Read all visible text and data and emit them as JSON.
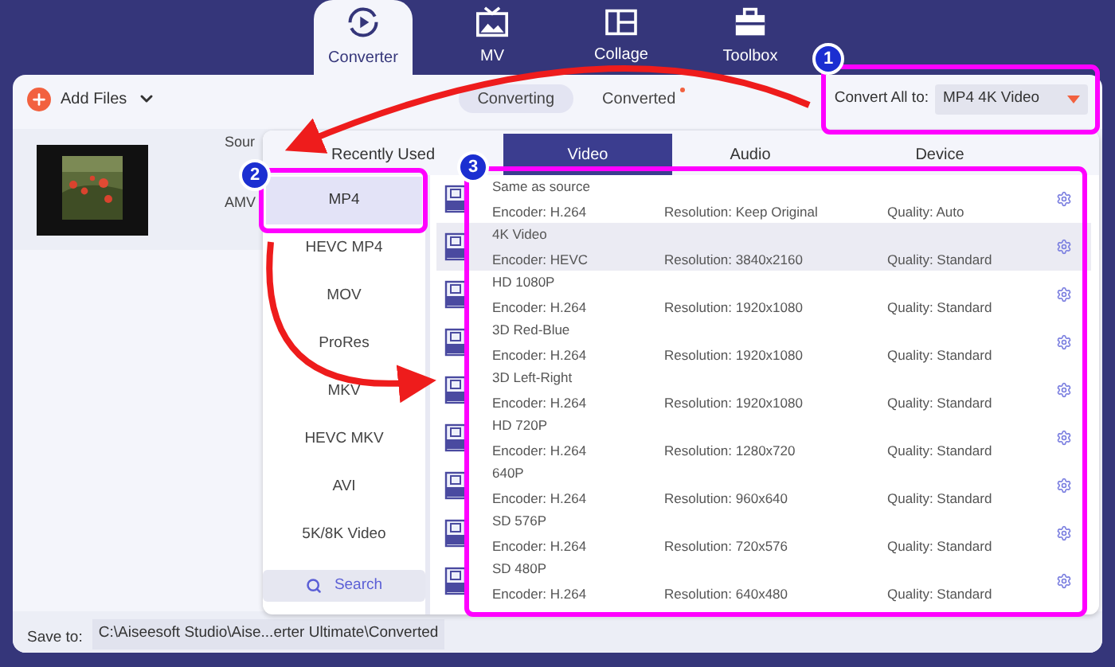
{
  "top_tabs": [
    {
      "label": "Converter",
      "kind": "converter",
      "selected": true
    },
    {
      "label": "MV",
      "kind": "mv",
      "selected": false
    },
    {
      "label": "Collage",
      "kind": "collage",
      "selected": false
    },
    {
      "label": "Toolbox",
      "kind": "toolbox",
      "selected": false
    }
  ],
  "toolbar": {
    "add_files": "Add Files",
    "view_tabs": [
      {
        "label": "Converting",
        "selected": true,
        "new_dot": false
      },
      {
        "label": "Converted",
        "selected": false,
        "new_dot": true
      }
    ],
    "convert_all_label": "Convert All to:",
    "convert_all_value": "MP4 4K Video"
  },
  "file": {
    "source_label": "Sour",
    "format": "AMV"
  },
  "format_popup": {
    "tabs": [
      {
        "label": "Recently Used",
        "selected": false
      },
      {
        "label": "Video",
        "selected": true
      },
      {
        "label": "Audio",
        "selected": false
      },
      {
        "label": "Device",
        "selected": false
      }
    ],
    "categories": [
      {
        "label": "MP4",
        "selected": true
      },
      {
        "label": "HEVC MP4",
        "selected": false
      },
      {
        "label": "MOV",
        "selected": false
      },
      {
        "label": "ProRes",
        "selected": false
      },
      {
        "label": "MKV",
        "selected": false
      },
      {
        "label": "HEVC MKV",
        "selected": false
      },
      {
        "label": "AVI",
        "selected": false
      },
      {
        "label": "5K/8K Video",
        "selected": false
      }
    ],
    "search": "Search",
    "formats": [
      {
        "name": "Same as source",
        "encoder": "Encoder: H.264",
        "resolution": "Resolution: Keep Original",
        "quality": "Quality: Auto",
        "selected": false
      },
      {
        "name": "4K Video",
        "encoder": "Encoder: HEVC",
        "resolution": "Resolution: 3840x2160",
        "quality": "Quality: Standard",
        "selected": true
      },
      {
        "name": "HD 1080P",
        "encoder": "Encoder: H.264",
        "resolution": "Resolution: 1920x1080",
        "quality": "Quality: Standard",
        "selected": false
      },
      {
        "name": "3D Red-Blue",
        "encoder": "Encoder: H.264",
        "resolution": "Resolution: 1920x1080",
        "quality": "Quality: Standard",
        "selected": false
      },
      {
        "name": "3D Left-Right",
        "encoder": "Encoder: H.264",
        "resolution": "Resolution: 1920x1080",
        "quality": "Quality: Standard",
        "selected": false
      },
      {
        "name": "HD 720P",
        "encoder": "Encoder: H.264",
        "resolution": "Resolution: 1280x720",
        "quality": "Quality: Standard",
        "selected": false
      },
      {
        "name": "640P",
        "encoder": "Encoder: H.264",
        "resolution": "Resolution: 960x640",
        "quality": "Quality: Standard",
        "selected": false
      },
      {
        "name": "SD 576P",
        "encoder": "Encoder: H.264",
        "resolution": "Resolution: 720x576",
        "quality": "Quality: Standard",
        "selected": false
      },
      {
        "name": "SD 480P",
        "encoder": "Encoder: H.264",
        "resolution": "Resolution: 640x480",
        "quality": "Quality: Standard",
        "selected": false
      }
    ]
  },
  "save_bar": {
    "label": "Save to:",
    "path": "C:\\Aiseesoft Studio\\Aise...erter Ultimate\\Converted"
  },
  "callouts": [
    {
      "number": "1"
    },
    {
      "number": "2"
    },
    {
      "number": "3"
    }
  ]
}
